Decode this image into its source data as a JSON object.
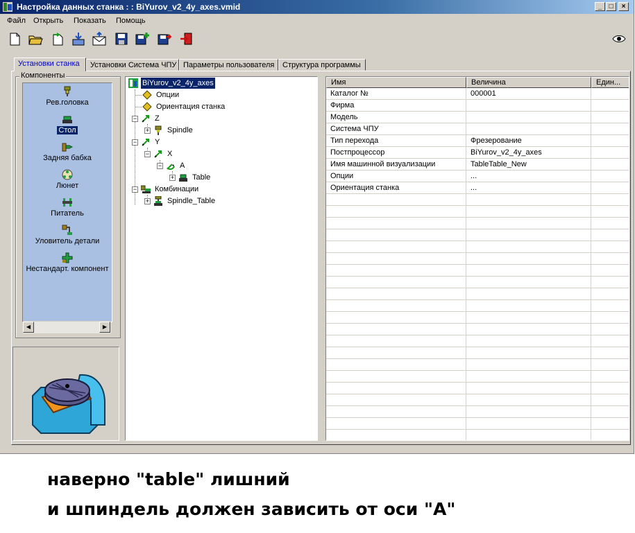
{
  "window": {
    "title": "Настройка данных станка : : BiYurov_v2_4y_axes.vmid"
  },
  "menu": [
    "Файл",
    "Открыть",
    "Показать",
    "Помощь"
  ],
  "tabs": [
    "Установки станка",
    "Установки Система ЧПУ",
    "Параметры пользователя",
    "Структура программы"
  ],
  "components": {
    "group_label": "Компоненты",
    "items": [
      "Рев.головка",
      "Стол",
      "Задняя бабка",
      "Люнет",
      "Питатель",
      "Уловитель детали",
      "Нестандарт. компонент"
    ],
    "selected": "Стол"
  },
  "tree": {
    "nodes": [
      "BiYurov_v2_4y_axes",
      "Опции",
      "Ориентация станка",
      "Z",
      "Spindle",
      "Y",
      "X",
      "A",
      "Table",
      "Комбинации",
      "Spindle_Table"
    ]
  },
  "grid": {
    "columns": [
      "Имя",
      "Величина",
      "Един..."
    ],
    "rows": [
      [
        "Каталог №",
        "000001",
        ""
      ],
      [
        "Фирма",
        "",
        ""
      ],
      [
        "Модель",
        "",
        ""
      ],
      [
        "Система ЧПУ",
        "",
        ""
      ],
      [
        "Тип перехода",
        "Фрезерование",
        ""
      ],
      [
        "Постпроцессор",
        "BiYurov_v2_4y_axes",
        ""
      ],
      [
        "Имя машинной визуализации",
        "TableTable_New",
        ""
      ],
      [
        "Опции",
        "...",
        ""
      ],
      [
        "Ориентация станка",
        "...",
        ""
      ]
    ]
  },
  "caption": {
    "line1": "наверно \"table\" лишний",
    "line2": "и шпиндель должен зависить от оси \"A\""
  },
  "colors": {
    "title_bar": "#0a246a",
    "face": "#d4d0c8",
    "component_list": "#a9c0e2",
    "selection": "#0a246a"
  }
}
